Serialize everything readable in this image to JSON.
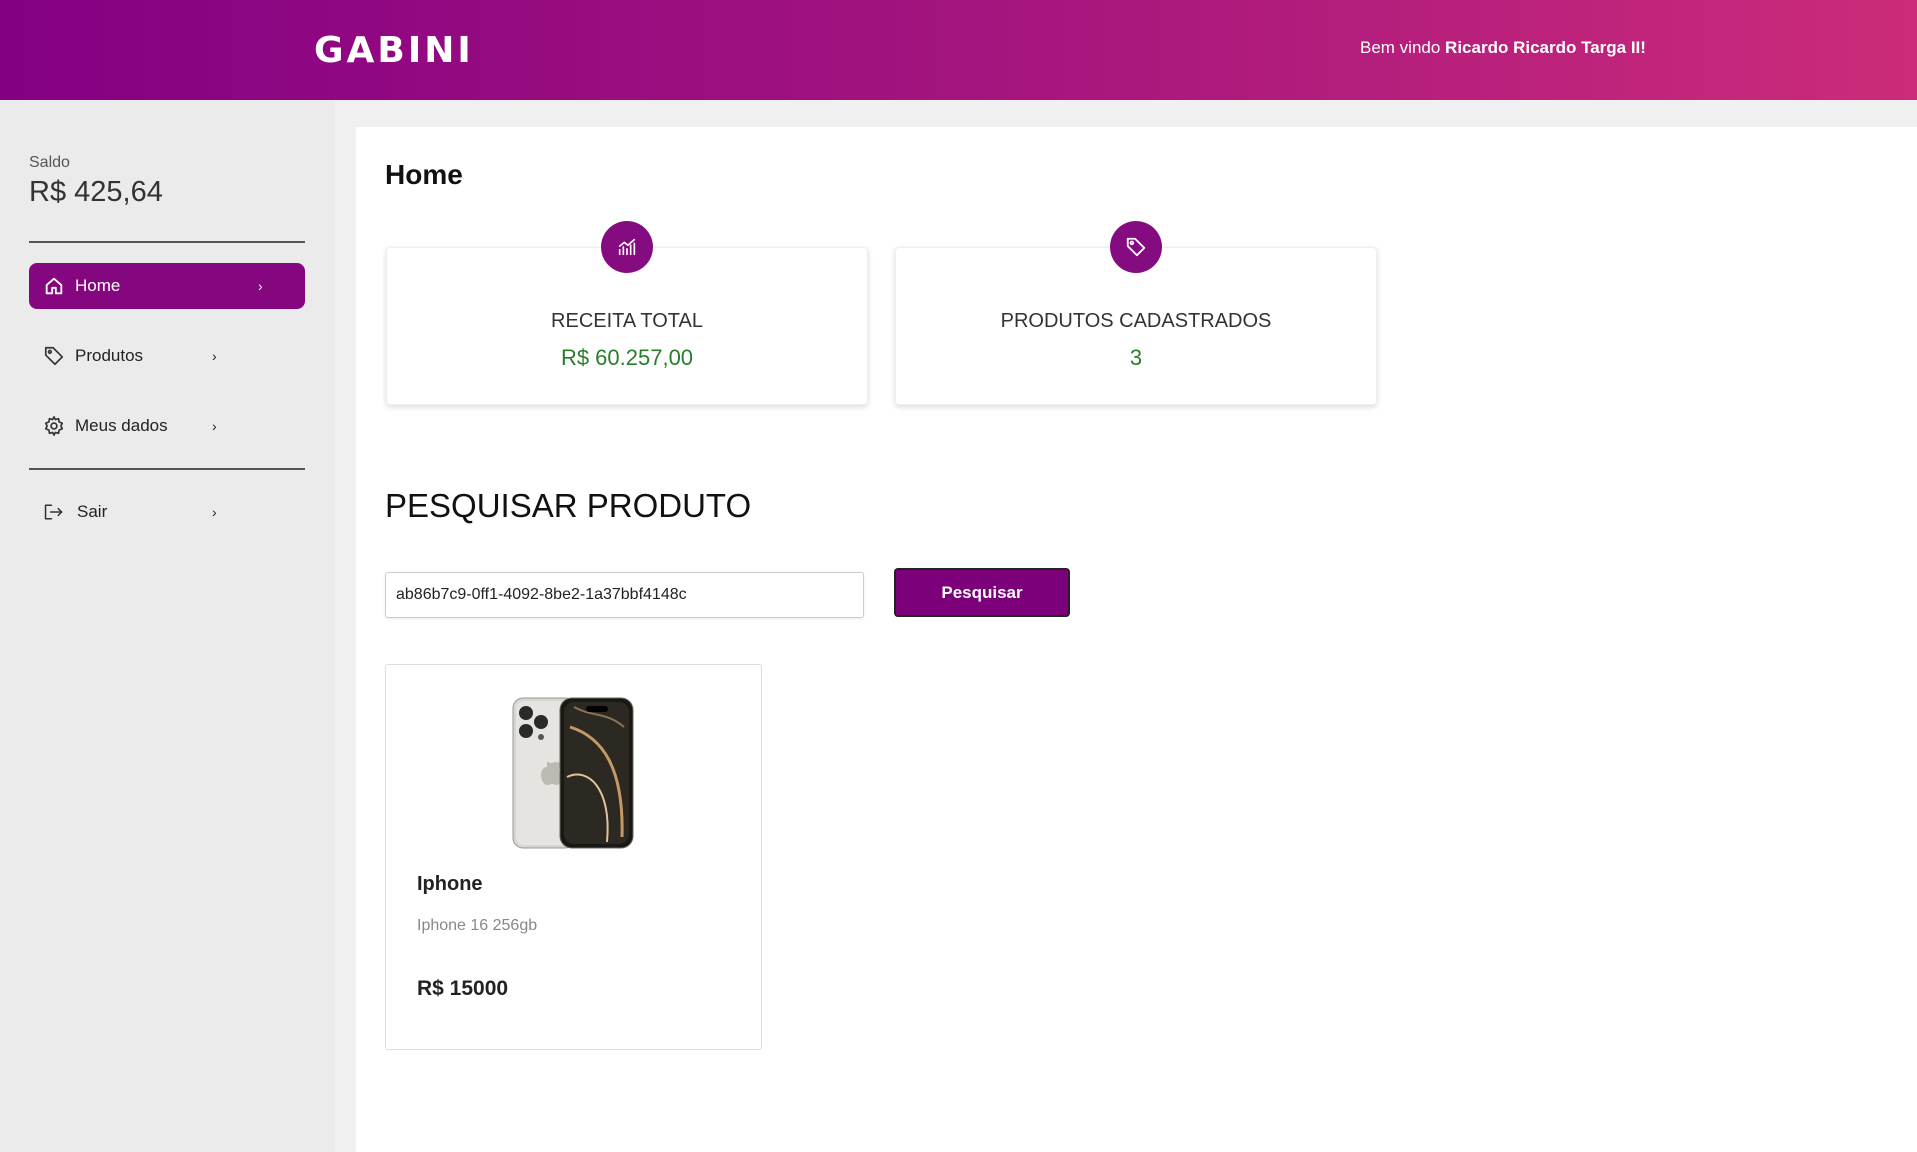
{
  "header": {
    "logo": "GABINI",
    "welcome_prefix": "Bem vindo ",
    "welcome_name": "Ricardo Ricardo Targa II!"
  },
  "sidebar": {
    "saldo_label": "Saldo",
    "saldo_value": "R$ 425,64",
    "items": [
      {
        "label": "Home",
        "icon": "home-icon",
        "active": true
      },
      {
        "label": "Produtos",
        "icon": "tag-icon",
        "active": false
      },
      {
        "label": "Meus dados",
        "icon": "gear-icon",
        "active": false
      },
      {
        "label": "Sair",
        "icon": "logout-icon",
        "active": false
      }
    ],
    "chevron": "›"
  },
  "main": {
    "title": "Home",
    "stats": [
      {
        "title": "RECEITA TOTAL",
        "value": "R$ 60.257,00",
        "icon": "chart-icon"
      },
      {
        "title": "PRODUTOS CADASTRADOS",
        "value": "3",
        "icon": "tag-icon"
      }
    ],
    "search": {
      "title": "PESQUISAR PRODUTO",
      "value": "ab86b7c9-0ff1-4092-8be2-1a37bbf4148c",
      "button_label": "Pesquisar"
    },
    "products": [
      {
        "name": "Iphone",
        "description": "Iphone 16 256gb",
        "price": "R$ 15000"
      }
    ]
  },
  "colors": {
    "primary": "#85077f",
    "header_start": "#840083",
    "header_end": "#cc2b7a",
    "value_green": "#2a7d2a"
  }
}
